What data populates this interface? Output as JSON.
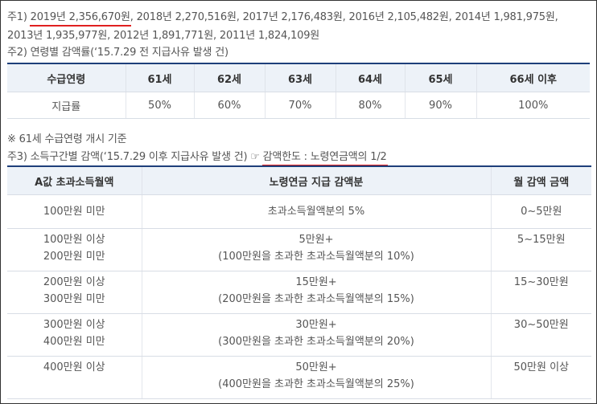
{
  "note1": {
    "prefix": "주1) ",
    "highlight": "2019년 2,356,670원",
    "rest_line1": ", 2018년 2,270,516원, 2017년 2,176,483원, 2016년 2,105,482원, 2014년 1,981,975원,",
    "line2": "2013년 1,935,977원, 2012년 1,891,771원, 2011년 1,824,109원"
  },
  "note2": {
    "text": "주2) 연령별 감액률(‘15.7.29 전 지급사유 발생 건)"
  },
  "table1": {
    "headers": [
      "수급연령",
      "61세",
      "62세",
      "63세",
      "64세",
      "65세",
      "66세 이후"
    ],
    "row": [
      "지급률",
      "50%",
      "60%",
      "70%",
      "80%",
      "90%",
      "100%"
    ]
  },
  "basis_note": "※ 61세 수급연령 개시 기준",
  "note3": {
    "prefix": "주3) 소득구간별 감액(‘15.7.29 이후 지급사유 발생 건) ☞ ",
    "highlight": "감액한도 : 노령연금액의 1/2"
  },
  "table2": {
    "headers": [
      "A값 초과소득월액",
      "노령연금 지급 감액분",
      "월 감액 금액"
    ],
    "rows": [
      {
        "income": [
          "100만원 미만"
        ],
        "reduction": [
          "초과소득월액분의 5%"
        ],
        "monthly": "0~5만원"
      },
      {
        "income": [
          "100만원 이상",
          "200만원 미만"
        ],
        "reduction": [
          "5만원+",
          "(100만원을 초과한 초과소득월액분의 10%)"
        ],
        "monthly": "5~15만원"
      },
      {
        "income": [
          "200만원 이상",
          "300만원 미만"
        ],
        "reduction": [
          "15만원+",
          "(200만원을 초과한 초과소득월액분의 15%)"
        ],
        "monthly": "15~30만원"
      },
      {
        "income": [
          "300만원 이상",
          "400만원 미만"
        ],
        "reduction": [
          "30만원+",
          "(300만원을 초과한 초과소득월액분의 20%)"
        ],
        "monthly": "30~50만원"
      },
      {
        "income": [
          "400만원 이상"
        ],
        "reduction": [
          "50만원+",
          "(400만원을 초과한 초과소득월액분의 25%)"
        ],
        "monthly": "50만원 이상"
      }
    ]
  },
  "colors": {
    "header_bg": "#edf2f8",
    "top_border": "#1e3f7a",
    "underline": "#e02020",
    "text": "#555555"
  }
}
